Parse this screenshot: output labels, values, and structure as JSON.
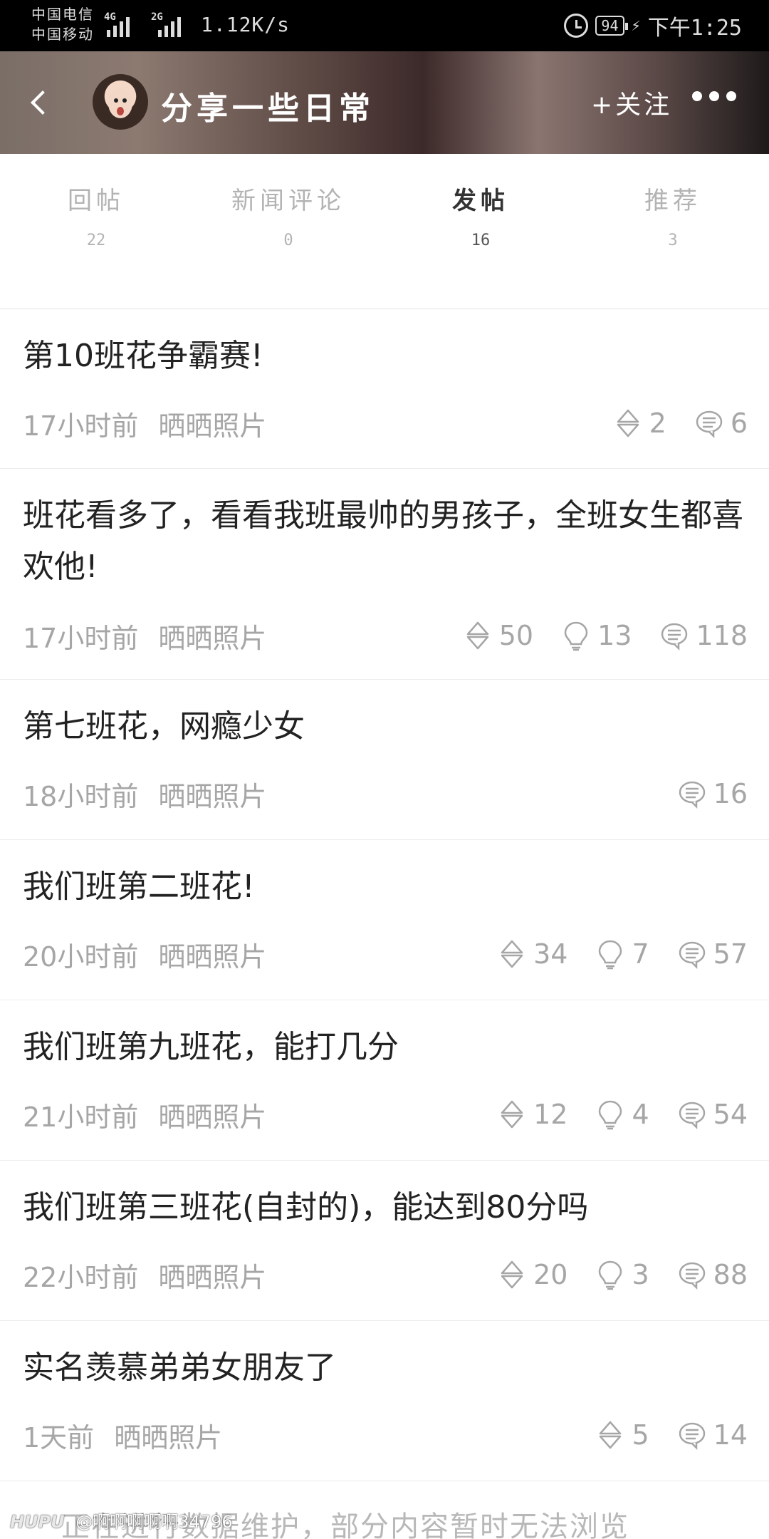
{
  "status_bar": {
    "carrier1": "中国电信",
    "carrier2": "中国移动",
    "sig1": "4G",
    "sig2": "2G",
    "net_speed": "1.12K/s",
    "battery": "94",
    "time": "下午1:25"
  },
  "header": {
    "title": "分享一些日常",
    "follow_label": "+关注"
  },
  "tabs": [
    {
      "label": "回帖",
      "count": "22"
    },
    {
      "label": "新闻评论",
      "count": "0"
    },
    {
      "label": "发帖",
      "count": "16"
    },
    {
      "label": "推荐",
      "count": "3"
    }
  ],
  "active_tab": "发帖",
  "posts": [
    {
      "title": "第10班花争霸赛!",
      "time": "17小时前",
      "category": "晒晒照片",
      "likes": "2",
      "comments": "6"
    },
    {
      "title": "班花看多了，看看我班最帅的男孩子，全班女生都喜欢他!",
      "time": "17小时前",
      "category": "晒晒照片",
      "likes": "50",
      "lights": "13",
      "comments": "118"
    },
    {
      "title": "第七班花，网瘾少女",
      "time": "18小时前",
      "category": "晒晒照片",
      "comments": "16"
    },
    {
      "title": "我们班第二班花!",
      "time": "20小时前",
      "category": "晒晒照片",
      "likes": "34",
      "lights": "7",
      "comments": "57"
    },
    {
      "title": "我们班第九班花，能打几分",
      "time": "21小时前",
      "category": "晒晒照片",
      "likes": "12",
      "lights": "4",
      "comments": "54"
    },
    {
      "title": "我们班第三班花(自封的)，能达到80分吗",
      "time": "22小时前",
      "category": "晒晒照片",
      "likes": "20",
      "lights": "3",
      "comments": "88"
    },
    {
      "title": "实名羡慕弟弟女朋友了",
      "time": "1天前",
      "category": "晒晒照片",
      "likes": "5",
      "comments": "14"
    }
  ],
  "notice": "正在进行数据维护，部分内容暂时无法浏览",
  "watermark": {
    "logo": "HUPU",
    "user": "@啊啊啊啊啊34796"
  }
}
